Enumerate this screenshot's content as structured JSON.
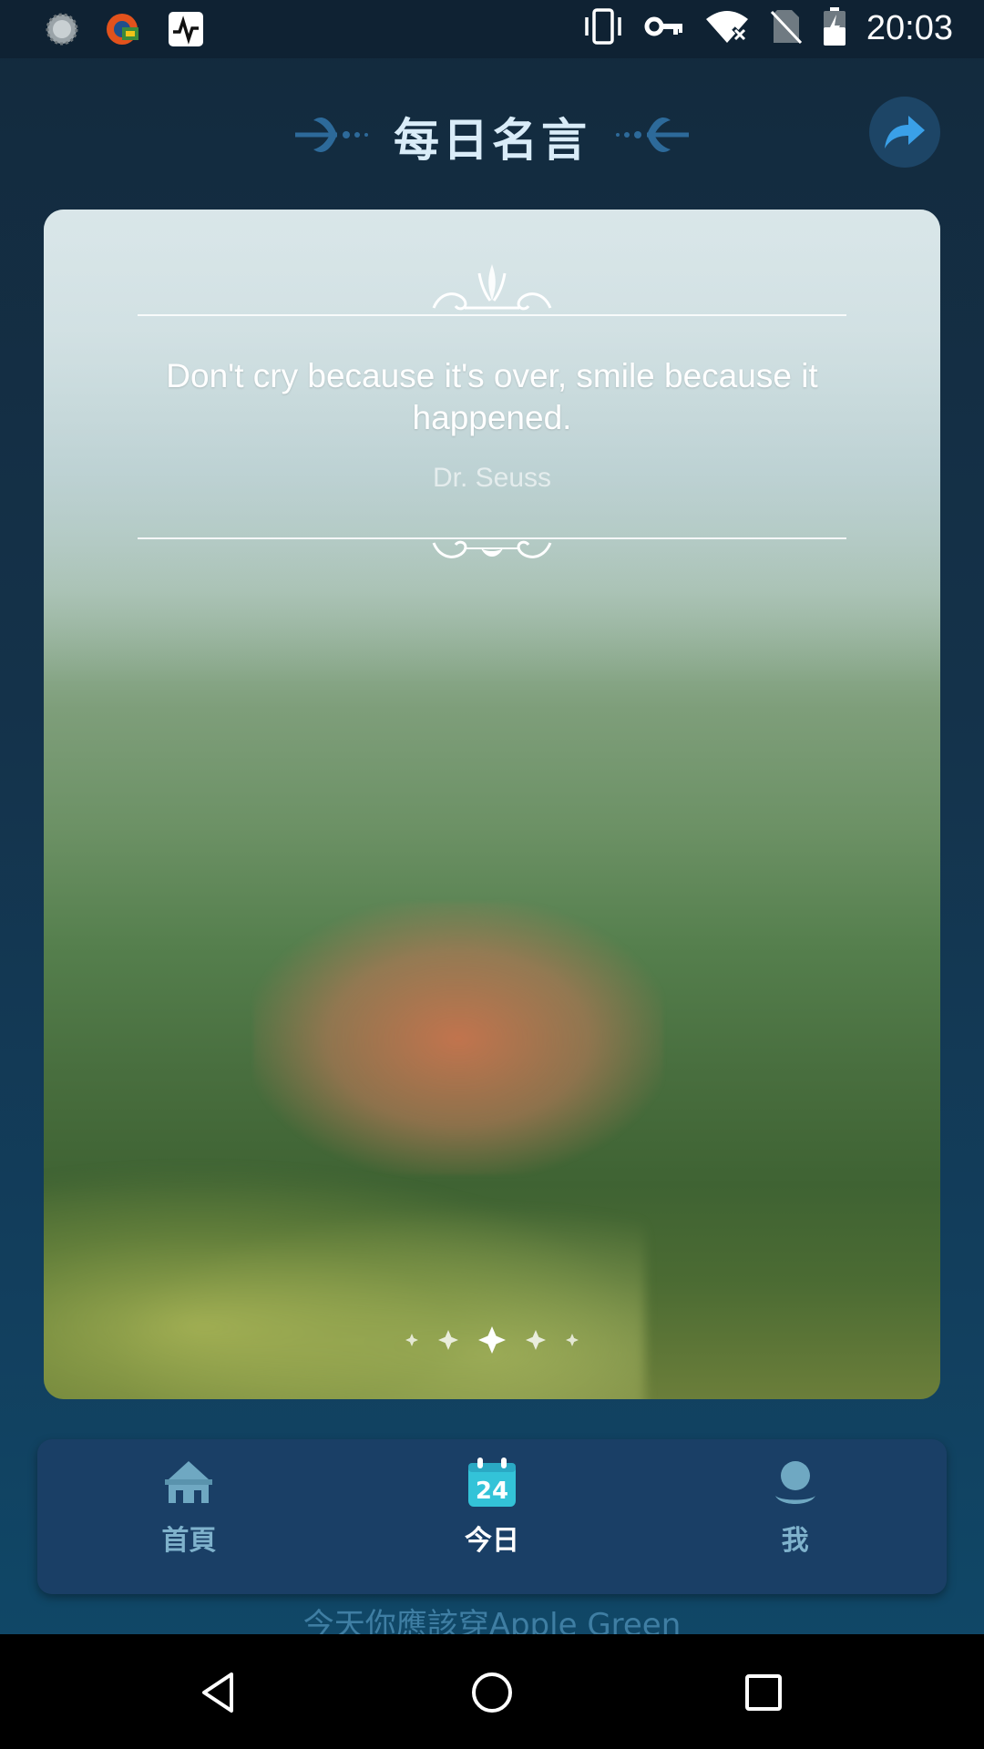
{
  "status_bar": {
    "time": "20:03",
    "left_icons": [
      "sync-icon",
      "app-notification-icon",
      "activity-monitor-icon"
    ],
    "right_icons": [
      "vibrate-icon",
      "vpn-key-icon",
      "wifi-off-icon",
      "no-sim-icon",
      "battery-charging-icon"
    ]
  },
  "header": {
    "title": "每日名言",
    "share_icon": "share-icon"
  },
  "quote": {
    "text": "Don't cry because it's over, smile because it happened.",
    "author": "Dr. Seuss"
  },
  "pager": {
    "count": 5,
    "active_index": 2
  },
  "nav": {
    "items": [
      {
        "label": "首頁",
        "icon": "home-icon",
        "active": false
      },
      {
        "label": "今日",
        "icon": "calendar-icon",
        "icon_text": "24",
        "active": true
      },
      {
        "label": "我",
        "icon": "profile-icon",
        "active": false
      }
    ]
  },
  "footer": {
    "text": "今天你應該穿Apple Green"
  },
  "colors": {
    "background": "#132a3d",
    "nav_background": "#1a3f66",
    "nav_inactive": "#7fb2cc",
    "nav_active": "#ffffff",
    "accent": "#2a7fb5"
  }
}
